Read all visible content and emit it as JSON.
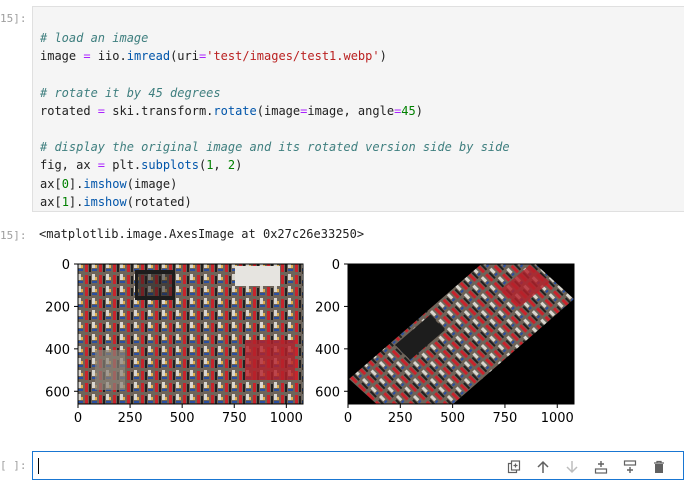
{
  "cells": [
    {
      "prompt": "15]:",
      "code_lines": [
        {
          "type": "comment",
          "text": "# load an image"
        },
        {
          "type": "code",
          "parts": [
            {
              "t": "",
              "v": "image "
            },
            {
              "t": "op",
              "v": "="
            },
            {
              "t": "",
              "v": " iio."
            },
            {
              "t": "fn",
              "v": "imread"
            },
            {
              "t": "",
              "v": "(uri"
            },
            {
              "t": "op",
              "v": "="
            },
            {
              "t": "str",
              "v": "'test/images/test1.webp'"
            },
            {
              "t": "",
              "v": ")"
            }
          ]
        },
        {
          "type": "blank",
          "text": ""
        },
        {
          "type": "comment",
          "text": "# rotate it by 45 degrees"
        },
        {
          "type": "code",
          "parts": [
            {
              "t": "",
              "v": "rotated "
            },
            {
              "t": "op",
              "v": "="
            },
            {
              "t": "",
              "v": " ski.transform."
            },
            {
              "t": "fn",
              "v": "rotate"
            },
            {
              "t": "",
              "v": "(image"
            },
            {
              "t": "op",
              "v": "="
            },
            {
              "t": "",
              "v": "image, angle"
            },
            {
              "t": "op",
              "v": "="
            },
            {
              "t": "num",
              "v": "45"
            },
            {
              "t": "",
              "v": ")"
            }
          ]
        },
        {
          "type": "blank",
          "text": ""
        },
        {
          "type": "comment",
          "text": "# display the original image and its rotated version side by side"
        },
        {
          "type": "code",
          "parts": [
            {
              "t": "",
              "v": "fig, ax "
            },
            {
              "t": "op",
              "v": "="
            },
            {
              "t": "",
              "v": " plt."
            },
            {
              "t": "fn",
              "v": "subplots"
            },
            {
              "t": "",
              "v": "("
            },
            {
              "t": "num",
              "v": "1"
            },
            {
              "t": "",
              "v": ", "
            },
            {
              "t": "num",
              "v": "2"
            },
            {
              "t": "",
              "v": ")"
            }
          ]
        },
        {
          "type": "code",
          "parts": [
            {
              "t": "",
              "v": "ax["
            },
            {
              "t": "num",
              "v": "0"
            },
            {
              "t": "",
              "v": "]."
            },
            {
              "t": "fn",
              "v": "imshow"
            },
            {
              "t": "",
              "v": "(image)"
            }
          ]
        },
        {
          "type": "code",
          "parts": [
            {
              "t": "",
              "v": "ax["
            },
            {
              "t": "num",
              "v": "1"
            },
            {
              "t": "",
              "v": "]."
            },
            {
              "t": "fn",
              "v": "imshow"
            },
            {
              "t": "",
              "v": "(rotated)"
            }
          ]
        }
      ]
    },
    {
      "prompt": "15]:",
      "output_text": "<matplotlib.image.AxesImage at 0x27c26e33250>"
    },
    {
      "prompt": "[ ]:",
      "toolbar": [
        "duplicate-icon",
        "move-up-icon",
        "move-down-icon",
        "insert-above-icon",
        "insert-below-icon",
        "delete-icon"
      ]
    }
  ],
  "chart_data": [
    {
      "type": "image",
      "xticks": [
        0,
        250,
        500,
        750,
        1000
      ],
      "yticks": [
        0,
        200,
        400,
        600
      ],
      "xlim": [
        0,
        1080
      ],
      "ylim": [
        660,
        0
      ]
    },
    {
      "type": "image",
      "xticks": [
        0,
        250,
        500,
        750,
        1000
      ],
      "yticks": [
        0,
        200,
        400,
        600
      ],
      "xlim": [
        0,
        1080
      ],
      "ylim": [
        660,
        0
      ]
    }
  ],
  "colors": {
    "prompt": "#9e9e9e",
    "active_border": "#1976d2",
    "input_bg": "#f5f5f5"
  }
}
